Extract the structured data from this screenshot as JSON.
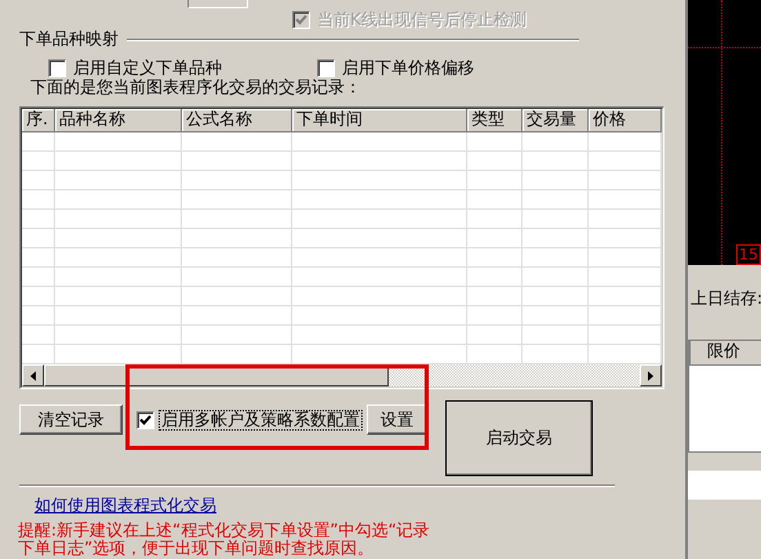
{
  "top_options": [
    {
      "label": "当前K线出现信号后停止检测",
      "checked": true,
      "disabled": true
    }
  ],
  "mapping_group": {
    "title": "下单品种映射",
    "options": [
      {
        "label": "启用自定义下单品种",
        "checked": false
      },
      {
        "label": "启用下单价格偏移",
        "checked": false
      }
    ]
  },
  "records_caption": "下面的是您当前图表程序化交易的交易记录：",
  "records_table": {
    "columns": [
      "序.",
      "品种名称",
      "公式名称",
      "下单时间",
      "类型",
      "交易量",
      "价格"
    ]
  },
  "actions": {
    "clear_button": "清空记录",
    "multi_account": {
      "label": "启用多帐户及策略系数配置",
      "checked": true
    },
    "settings_button": "设置",
    "start_button": "启动交易"
  },
  "help_link": "如何使用图表程式化交易",
  "reminder_lines": [
    "提醒:新手建议在上述“程式化交易下单设置”中勾选“记录",
    "下单日志”选项，便于出现下单问题时查找原因。"
  ],
  "side_panel": {
    "chart_value": "15",
    "balance_label": "上日结存:",
    "table_columns": [
      "限价"
    ]
  }
}
